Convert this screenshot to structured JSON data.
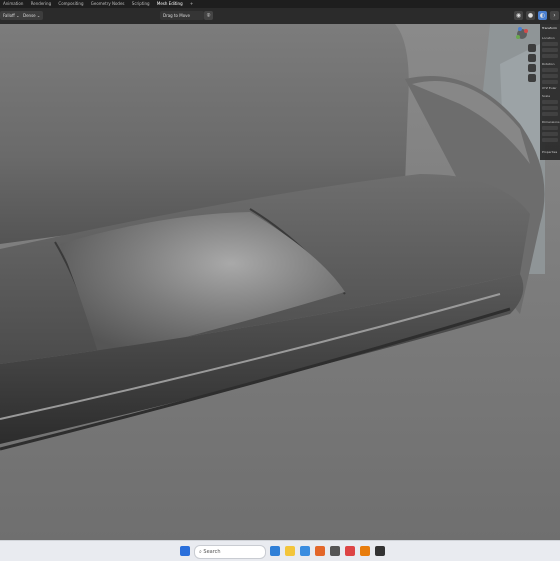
{
  "topbar": {
    "tabs": [
      "Animation",
      "Rendering",
      "Compositing",
      "Geometry Nodes",
      "Scripting",
      "Mesh Editing"
    ],
    "add_tab": "+"
  },
  "header": {
    "falloff_label": "Falloff",
    "brush_label": "Dense",
    "center_label": "Drag to Move",
    "sidebar_tab": "N"
  },
  "npanel": {
    "title": "Transform",
    "location": "Location",
    "rotation": "Rotation",
    "scale": "Scale",
    "dimensions": "Dimensions",
    "xyz": [
      "X",
      "Y",
      "Z"
    ],
    "mode": "XYZ Euler",
    "properties": "Properties"
  },
  "taskbar": {
    "search_placeholder": "Search"
  },
  "colors": {
    "accent": "#4a7fd0",
    "ui_dark": "#2b2b2b",
    "viewport_floor": "#7b7b7b",
    "sofa": "#5f5f5f"
  }
}
